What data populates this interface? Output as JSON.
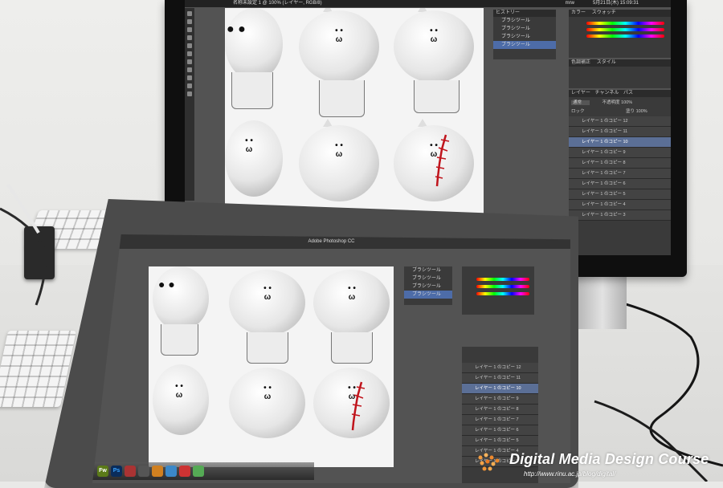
{
  "monitor": {
    "menubar_time": "5月21日(木) 15:09:31",
    "menubar_user": "mrw",
    "doc_tab": "名称未設定 1 @ 100% (レイヤー, RGB/8)",
    "history_title": "ヒストリー",
    "history_items": [
      "ブラシツール",
      "ブラシツール",
      "ブラシツール",
      "ブラシツール"
    ],
    "color_title": "カラー",
    "swatch_title": "スウォッチ",
    "adjust_title": "色調補正",
    "style_title": "スタイル",
    "layers_tabs": [
      "レイヤー",
      "チャンネル",
      "パス"
    ],
    "blend_mode": "通常",
    "opacity_label": "不透明度",
    "opacity_value": "100%",
    "fill_label": "塗り",
    "fill_value": "100%",
    "lock_label": "ロック",
    "layers": [
      "レイヤー 1 のコピー 12",
      "レイヤー 1 のコピー 11",
      "レイヤー 1 のコピー 10",
      "レイヤー 1 のコピー 9",
      "レイヤー 1 のコピー 8",
      "レイヤー 1 のコピー 7",
      "レイヤー 1 のコピー 6",
      "レイヤー 1 のコピー 5",
      "レイヤー 1 のコピー 4",
      "レイヤー 1 のコピー 3"
    ],
    "selected_layer": 2
  },
  "tablet": {
    "app_title": "Adobe Photoshop CC",
    "history_items": [
      "ブラシツール",
      "ブラシツール",
      "ブラシツール",
      "ブラシツール"
    ],
    "layers": [
      "レイヤー 1 のコピー 12",
      "レイヤー 1 のコピー 11",
      "レイヤー 1 のコピー 10",
      "レイヤー 1 のコピー 9",
      "レイヤー 1 のコピー 8",
      "レイヤー 1 のコピー 7",
      "レイヤー 1 のコピー 6",
      "レイヤー 1 のコピー 5",
      "レイヤー 1 のコピー 4",
      "レイヤー 1 のコピー 3"
    ],
    "dock_icons": [
      "Fw",
      "Ps"
    ]
  },
  "watermark": {
    "title": "Digital Media Design Course",
    "url": "http://www.rinu.ac.jp/blog/digital/"
  },
  "colors": {
    "accent_select": "#4d6ca8",
    "stitch_red": "#c0141c"
  }
}
